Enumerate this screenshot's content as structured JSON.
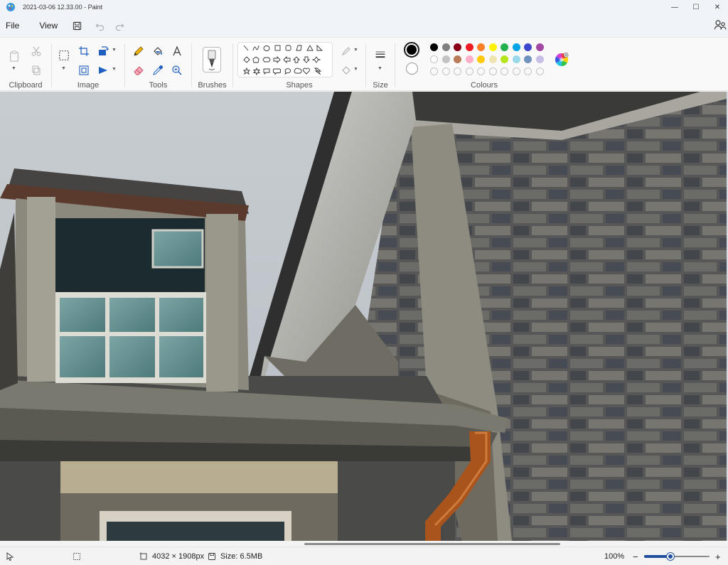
{
  "window": {
    "title": "2021-03-06 12.33.00 - Paint",
    "controls": {
      "minimize": "—",
      "maximize": "☐",
      "close": "✕"
    }
  },
  "menu": {
    "file": "File",
    "view": "View",
    "save_icon": "save-icon",
    "undo_icon": "undo-icon",
    "redo_icon": "redo-icon",
    "share_icon": "share-icon"
  },
  "ribbon": {
    "groups": {
      "clipboard": "Clipboard",
      "image": "Image",
      "tools": "Tools",
      "brushes": "Brushes",
      "shapes": "Shapes",
      "size": "Size",
      "colours": "Colours"
    },
    "colors": {
      "primary": "#000000",
      "secondary": "#ffffff",
      "palette_row1": [
        "#000000",
        "#7f7f7f",
        "#880015",
        "#ed1c24",
        "#ff7f27",
        "#fff200",
        "#22b14c",
        "#00a2e8",
        "#3f48cc",
        "#a349a4"
      ],
      "palette_row2": [
        "#ffffff",
        "#c3c3c3",
        "#b97a57",
        "#ffaec9",
        "#ffc90e",
        "#efe4b0",
        "#b5e61d",
        "#99d9ea",
        "#7092be",
        "#c8bfe7"
      ],
      "palette_row3_count": 10
    }
  },
  "statusbar": {
    "dimensions": "4032 × 1908px",
    "size": "Size: 6.5MB",
    "zoom": "100%",
    "zoom_out": "−",
    "zoom_in": "+",
    "zoom_level": 0.4
  }
}
